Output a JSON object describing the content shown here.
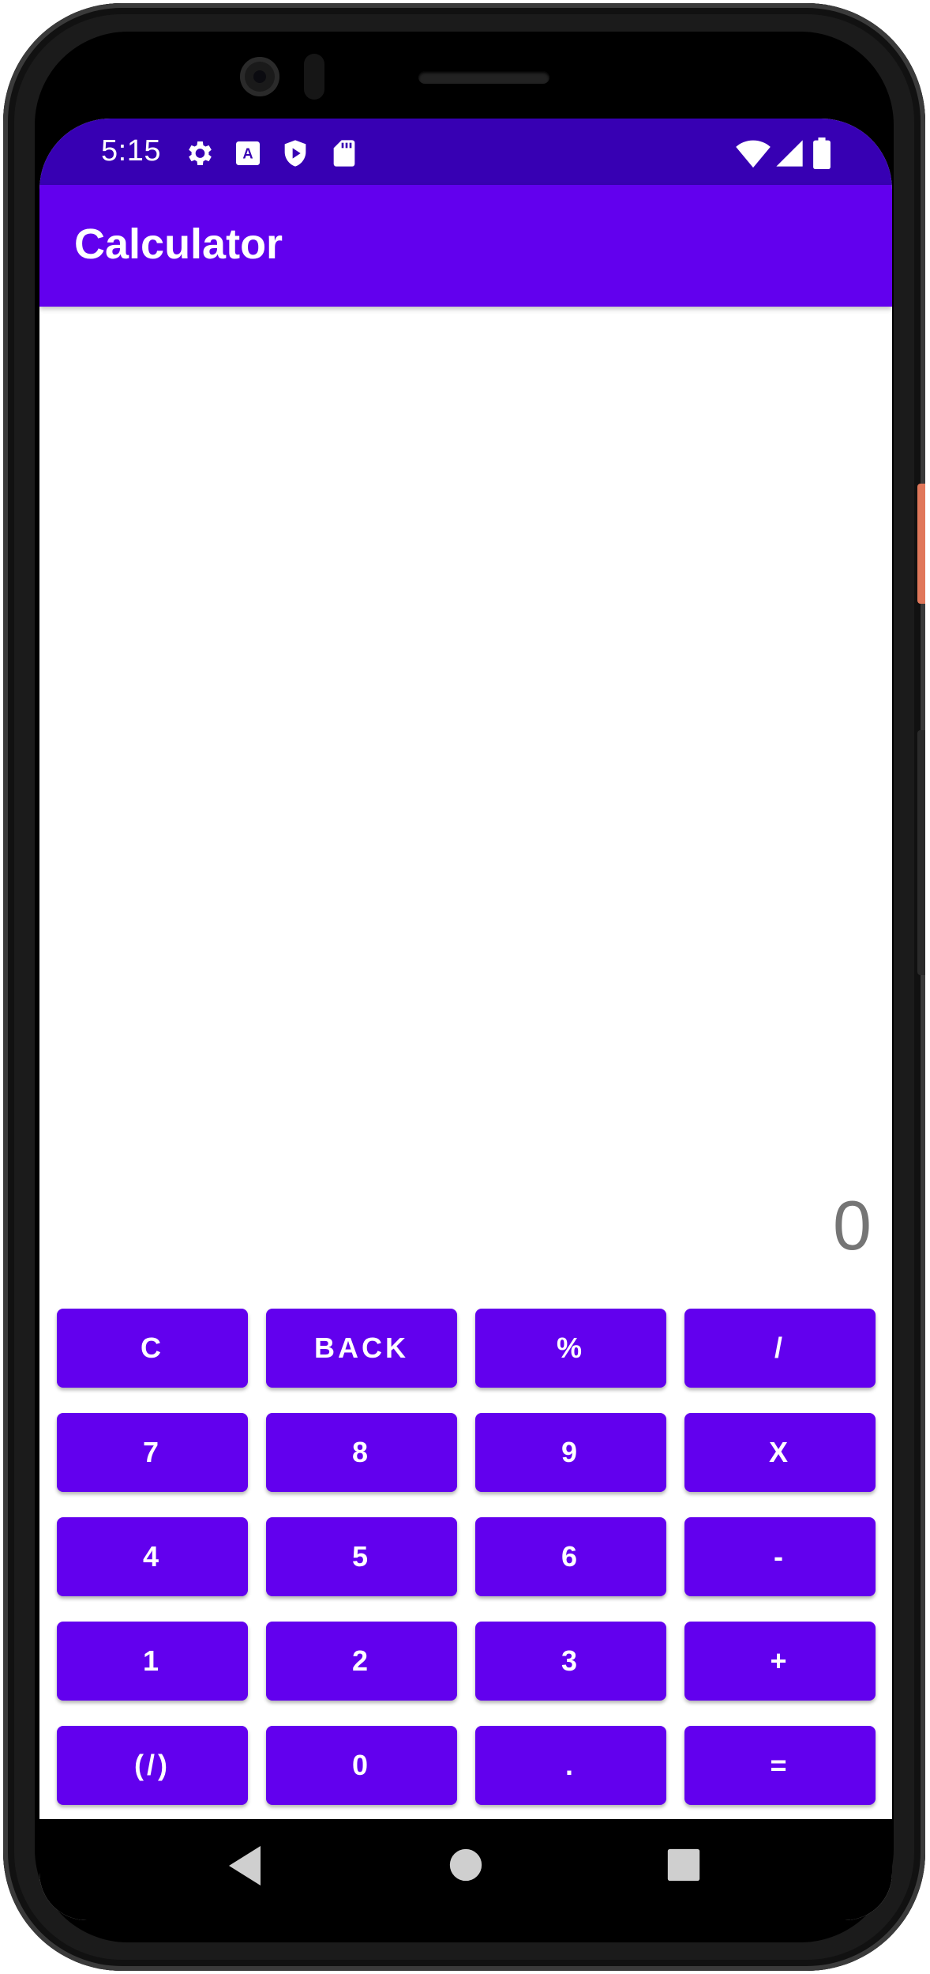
{
  "status_bar": {
    "time": "5:15",
    "left_icons": [
      "gear-icon",
      "font-a-icon",
      "shield-play-icon",
      "sd-card-icon"
    ],
    "right_icons": [
      "wifi-icon",
      "cell-signal-icon",
      "battery-icon"
    ]
  },
  "app_bar": {
    "title": "Calculator"
  },
  "display": {
    "value": "0"
  },
  "keypad": {
    "rows": [
      [
        "C",
        "BACK",
        "%",
        "/"
      ],
      [
        "7",
        "8",
        "9",
        "X"
      ],
      [
        "4",
        "5",
        "6",
        "-"
      ],
      [
        "1",
        "2",
        "3",
        "+"
      ],
      [
        "(/)",
        "0",
        ".",
        "="
      ]
    ]
  },
  "nav_bar": {
    "icons": [
      "back-icon",
      "home-icon",
      "recents-icon"
    ]
  },
  "colors": {
    "primary": "#6200ee",
    "primary_dark": "#3700b3",
    "display_text": "#757575"
  }
}
